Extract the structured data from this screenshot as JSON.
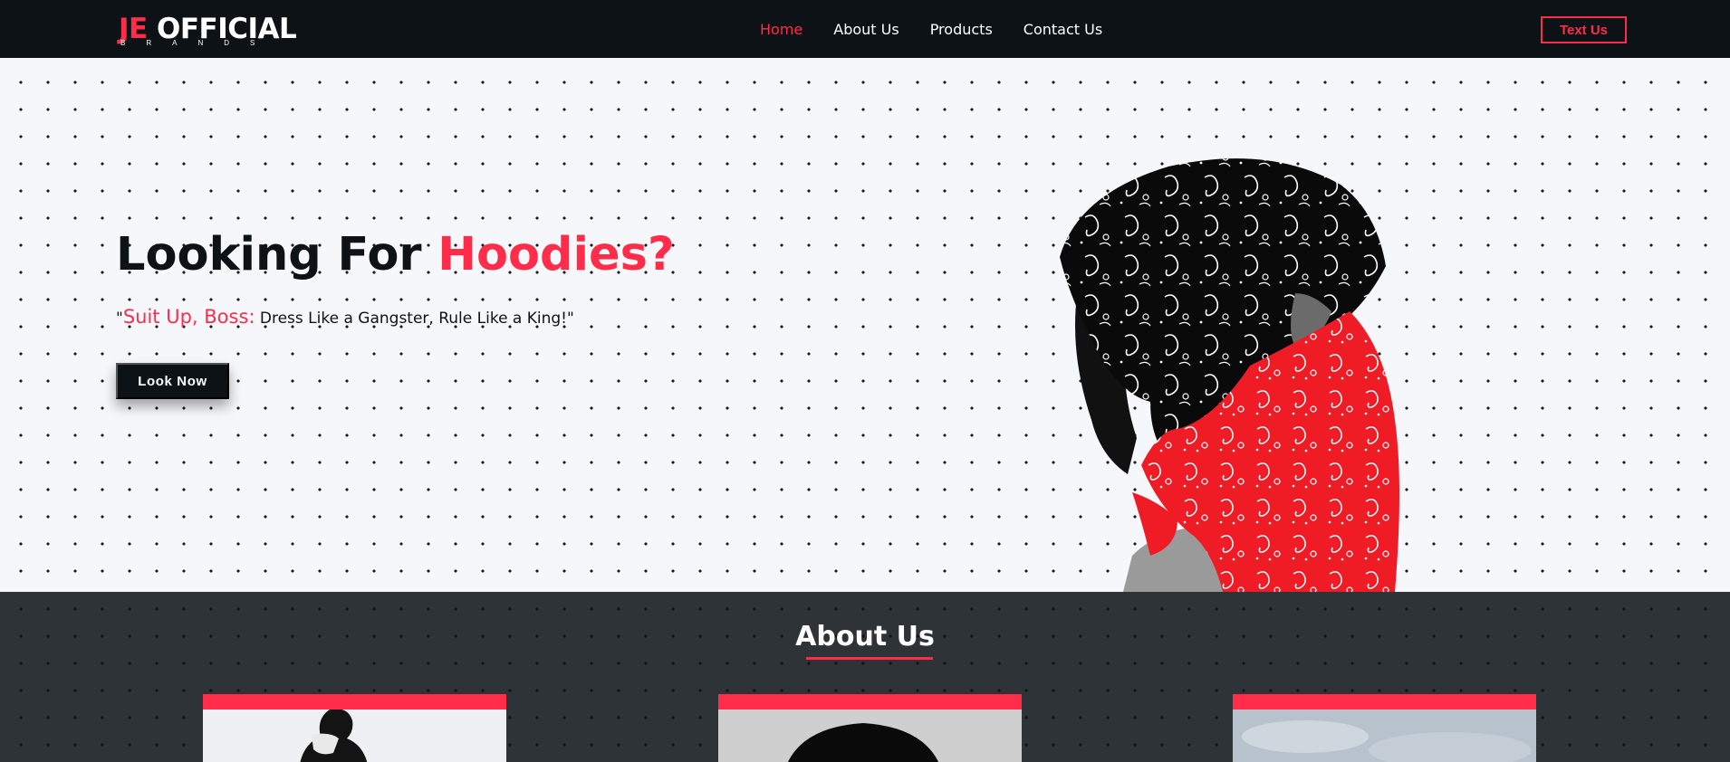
{
  "logo": {
    "je": "JE",
    "official": "OFFICIAL",
    "tagline": "BRANDS"
  },
  "nav": {
    "links": [
      "Home",
      "About Us",
      "Products",
      "Contact Us"
    ],
    "active": "Home",
    "cta": "Text Us"
  },
  "hero": {
    "title_prefix": "Looking For",
    "title_highlight": "Hoodies?",
    "quote_open": "\"",
    "quote_highlight": "Suit Up, Boss:",
    "quote_rest": " Dress Like a Gangster, Rule Like a King!\"",
    "button": "Look Now"
  },
  "about": {
    "title": "About Us"
  },
  "colors": {
    "accent": "#ff2d4a",
    "dark": "#0c1216",
    "hero_bg": "#f6f7fb",
    "about_bg": "#2e3338"
  }
}
